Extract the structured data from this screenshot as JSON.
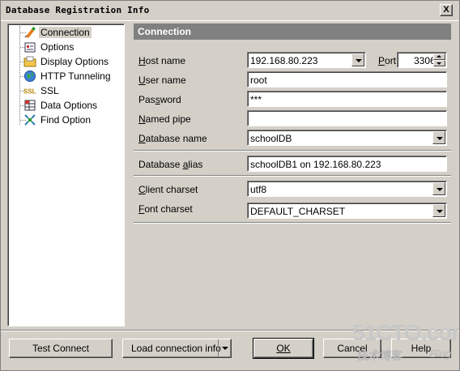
{
  "window": {
    "title": "Database Registration Info",
    "close_label": "X"
  },
  "tree": {
    "items": [
      {
        "label": "Connection",
        "icon": "connection-icon",
        "selected": true
      },
      {
        "label": "Options",
        "icon": "options-icon"
      },
      {
        "label": "Display Options",
        "icon": "folder-icon"
      },
      {
        "label": "HTTP Tunneling",
        "icon": "globe-icon"
      },
      {
        "label": "SSL",
        "icon": "ssl-icon"
      },
      {
        "label": "Data Options",
        "icon": "data-options-icon"
      },
      {
        "label": "Find Option",
        "icon": "find-icon"
      }
    ]
  },
  "panel": {
    "header": "Connection"
  },
  "form": {
    "host_label": "Host name",
    "host_value": "192.168.80.223",
    "port_label": "Port",
    "port_value": "3306",
    "user_label": "User name",
    "user_value": "root",
    "password_label": "Password",
    "password_value": "***",
    "pipe_label": "Named pipe",
    "pipe_value": "",
    "db_label": "Database name",
    "db_value": "schoolDB",
    "alias_label": "Database alias",
    "alias_value": "schoolDB1 on 192.168.80.223",
    "client_charset_label": "Client charset",
    "client_charset_value": "utf8",
    "font_charset_label": "Font charset",
    "font_charset_value": "DEFAULT_CHARSET"
  },
  "buttons": {
    "test": "Test Connect",
    "load": "Load connection info",
    "ok": "OK",
    "cancel": "Cancel",
    "help": "Help"
  },
  "watermark": {
    "site": "51CTO.com",
    "text": "技术博客",
    "blog": "Blog"
  }
}
